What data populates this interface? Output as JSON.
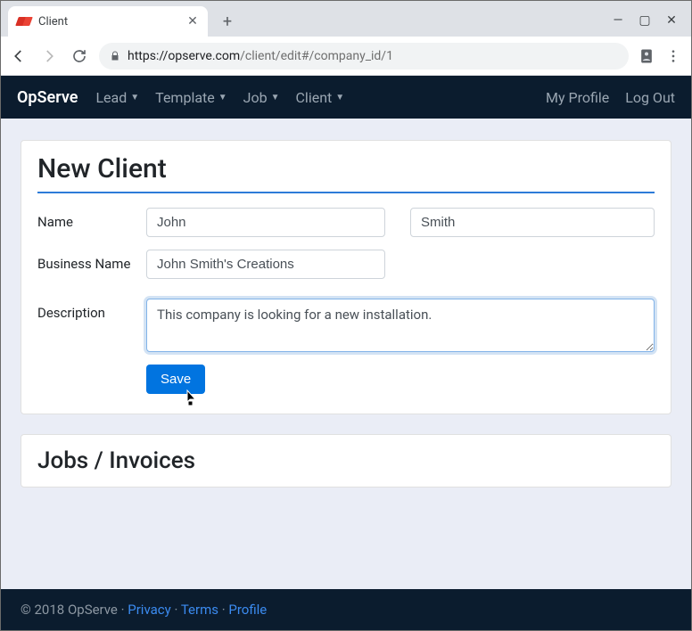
{
  "browser": {
    "tab_title": "Client",
    "url_host": "https://opserve.com",
    "url_path": "/client/edit#/company_id/1"
  },
  "navbar": {
    "brand": "OpServe",
    "links": [
      "Lead",
      "Template",
      "Job",
      "Client"
    ],
    "right": {
      "profile": "My Profile",
      "logout": "Log Out"
    }
  },
  "form": {
    "heading": "New Client",
    "name_label": "Name",
    "first_name": "John",
    "last_name": "Smith",
    "business_label": "Business Name",
    "business_name": "John Smith's Creations",
    "description_label": "Description",
    "description": "This company is looking for a new installation.",
    "save_label": "Save"
  },
  "section2": {
    "heading": "Jobs / Invoices"
  },
  "footer": {
    "copyright": "© 2018 OpServe",
    "sep": " · ",
    "privacy": "Privacy",
    "terms": "Terms",
    "profile": "Profile"
  }
}
